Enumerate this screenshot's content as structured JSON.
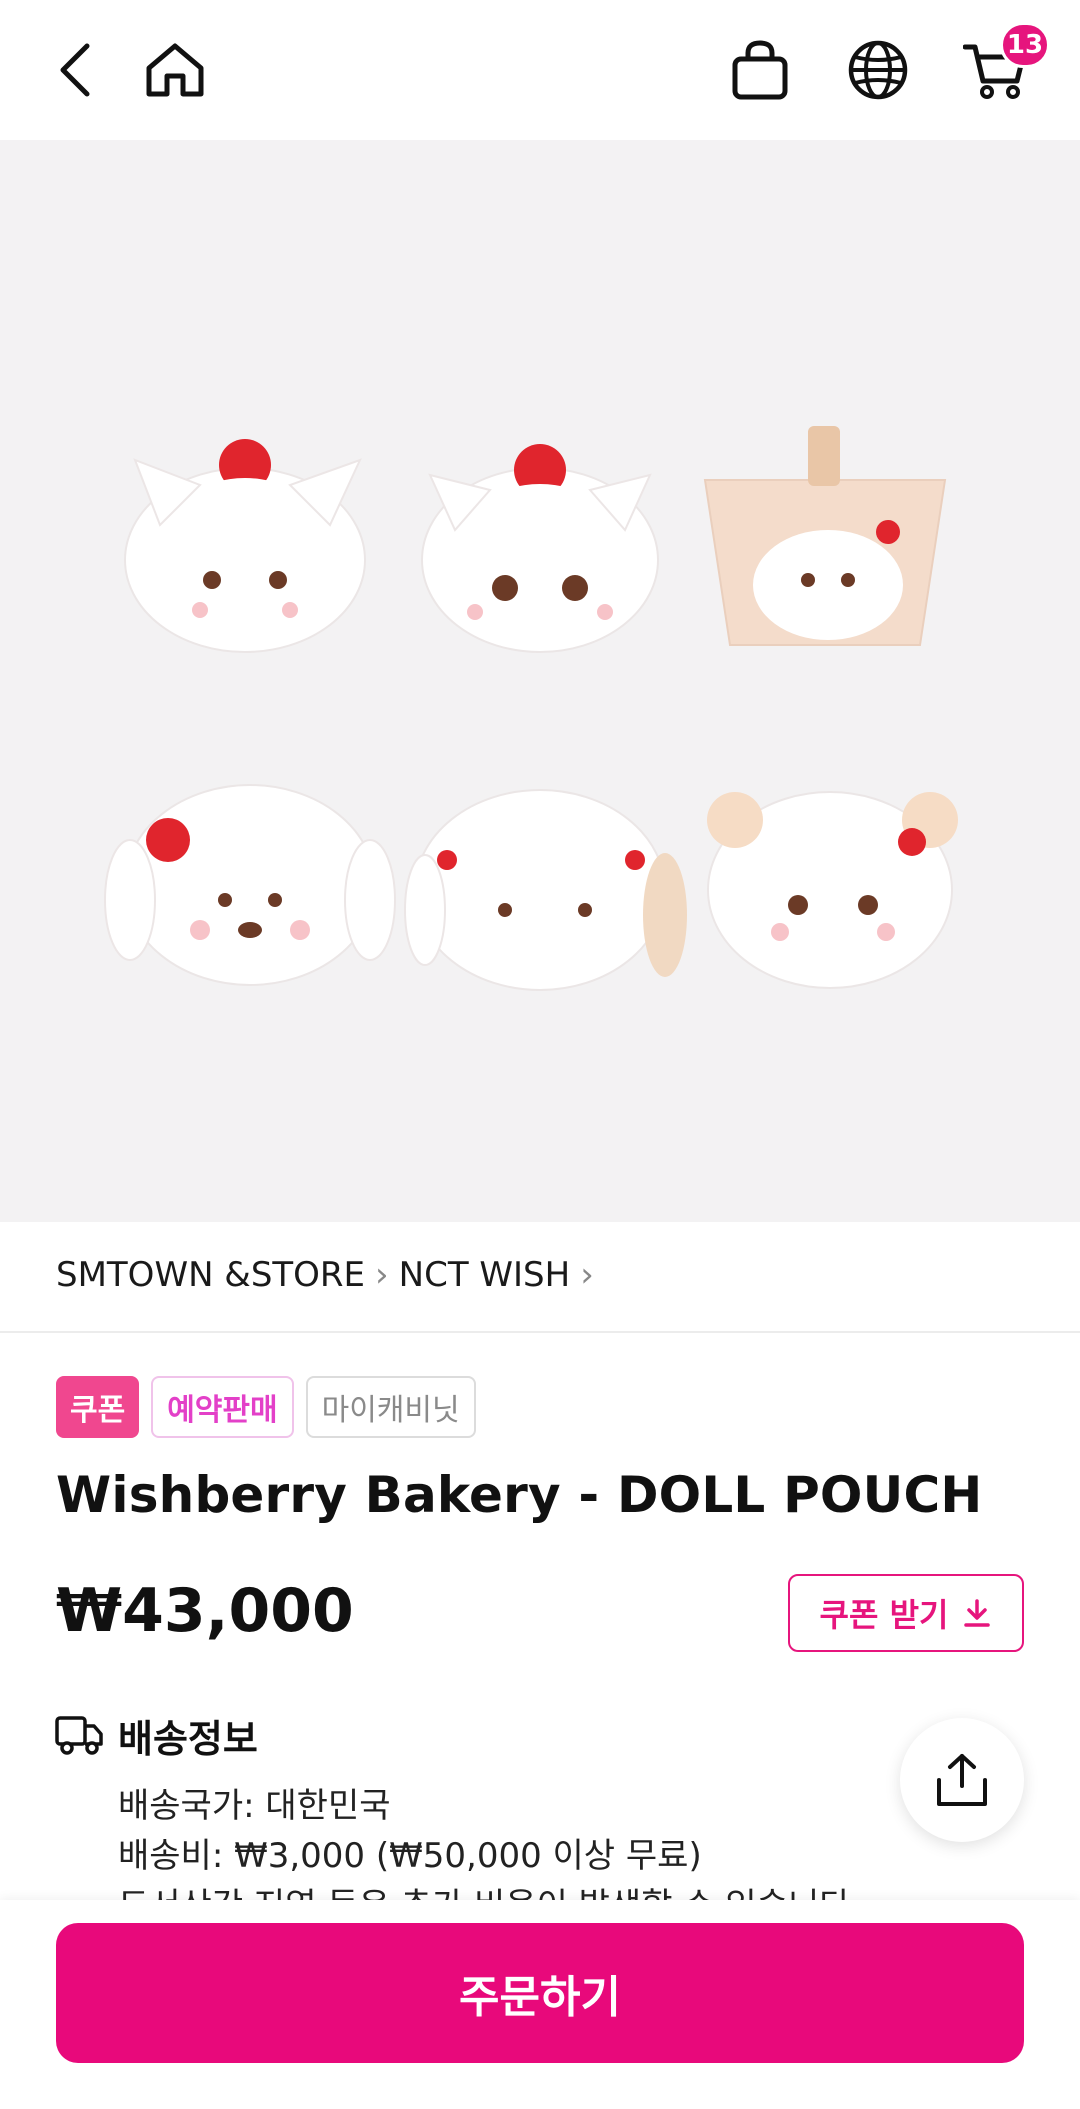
{
  "header": {
    "cart_count": "13",
    "icons": [
      "back-icon",
      "home-icon",
      "shopping-bag-icon",
      "globe-icon",
      "cart-icon"
    ]
  },
  "breadcrumb": {
    "items": [
      "SMTOWN &STORE",
      "NCT WISH"
    ]
  },
  "tags": {
    "coupon": "쿠폰",
    "preorder": "예약판매",
    "mycabinet": "마이캐비닛"
  },
  "product": {
    "title": "Wishberry Bakery - DOLL POUCH",
    "price": "₩43,000",
    "coupon_button": "쿠폰 받기"
  },
  "shipping": {
    "title": "배송정보",
    "country": "배송국가: 대한민국",
    "fee": "배송비: ₩3,000 (₩50,000 이상 무료)",
    "note": "도서산간 지역 등은 추가 비용이 발생할 수 있습니다"
  },
  "bottom": {
    "order_button": "주문하기"
  },
  "colors": {
    "accent": "#e8097b",
    "coupon_tag": "#f0478f",
    "preorder_text": "#e340c8"
  }
}
